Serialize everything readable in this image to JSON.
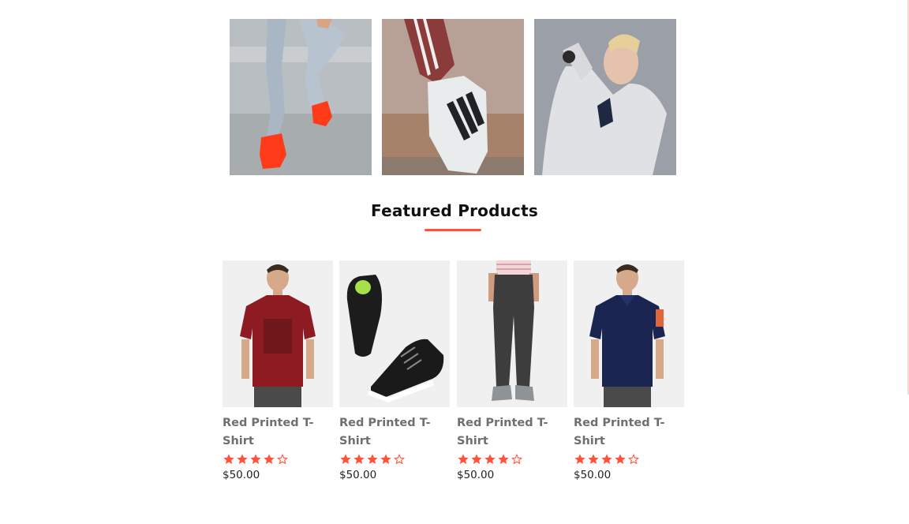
{
  "categories": [
    {
      "label": "category-sneakers-image"
    },
    {
      "label": "category-adidas-shoe-image"
    },
    {
      "label": "category-hoodie-image"
    }
  ],
  "featured": {
    "title": "Featured Products",
    "accent_color": "#ff523b"
  },
  "products": [
    {
      "name": "Red Printed T-Shirt",
      "rating": 4,
      "max_rating": 5,
      "price": "$50.00",
      "image": "red-tshirt"
    },
    {
      "name": "Red Printed T-Shirt",
      "rating": 4,
      "max_rating": 5,
      "price": "$50.00",
      "image": "black-shoes"
    },
    {
      "name": "Red Printed T-Shirt",
      "rating": 4,
      "max_rating": 5,
      "price": "$50.00",
      "image": "grey-joggers"
    },
    {
      "name": "Red Printed T-Shirt",
      "rating": 4,
      "max_rating": 5,
      "price": "$50.00",
      "image": "navy-polo"
    }
  ]
}
